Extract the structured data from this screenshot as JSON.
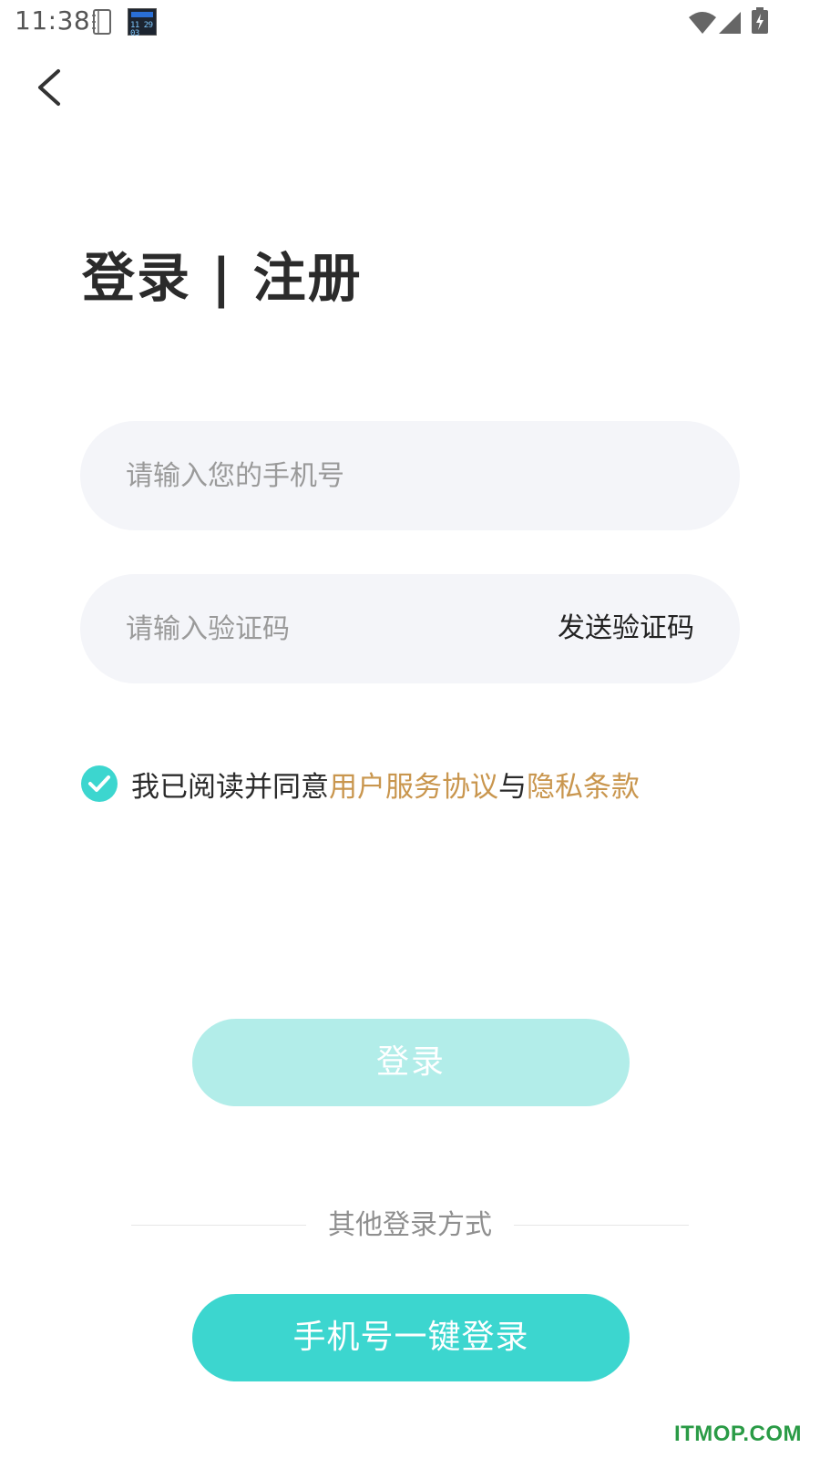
{
  "status_bar": {
    "time": "11:38",
    "clock_widget_digits": "11 29 03"
  },
  "header": {
    "title": "登录 | 注册"
  },
  "form": {
    "phone_placeholder": "请输入您的手机号",
    "code_placeholder": "请输入验证码",
    "send_code_label": "发送验证码"
  },
  "agreement": {
    "checked": true,
    "text_prefix": "我已阅读并同意",
    "terms_link": "用户服务协议",
    "connector": "与",
    "privacy_link": "隐私条款"
  },
  "actions": {
    "login_label": "登录",
    "other_methods_label": "其他登录方式",
    "one_click_label": "手机号一键登录"
  },
  "watermark": "ITMOP.COM",
  "colors": {
    "accent": "#3cd6cf",
    "accent_disabled": "#b2ede9",
    "link": "#c9964e",
    "input_bg": "#f4f5f9"
  },
  "icons": {
    "back": "chevron-left-icon",
    "check": "checkmark-circle-icon",
    "wifi": "wifi-icon",
    "signal": "cell-signal-icon",
    "battery": "battery-charging-icon"
  }
}
